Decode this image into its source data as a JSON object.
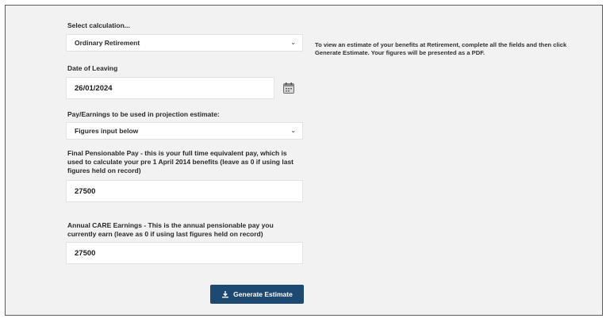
{
  "form": {
    "calc_label": "Select calculation...",
    "calc_value": "Ordinary Retirement",
    "date_label": "Date of Leaving",
    "date_value": "26/01/2024",
    "pay_label": "Pay/Earnings to be used in projection estimate:",
    "pay_value": "Figures input below",
    "fpp_label": "Final Pensionable Pay - this is your full time equivalent pay, which is used to calculate your pre 1 April 2014 benefits (leave as 0 if using last figures held on record)",
    "fpp_value": "27500",
    "care_label": "Annual CARE Earnings - This is the annual pensionable pay you currently earn (leave as 0 if using last figures held on record)",
    "care_value": "27500",
    "generate_label": "Generate Estimate"
  },
  "info": {
    "text": "To view an estimate of your benefits at Retirement, complete all the fields and then click Generate Estimate. Your figures will be presented as a PDF."
  },
  "icons": {
    "chevron": "chevron-down-icon",
    "calendar": "calendar-icon",
    "download": "download-icon"
  },
  "colors": {
    "primary_button": "#1c4a72",
    "panel_background": "#f2f2f2"
  }
}
